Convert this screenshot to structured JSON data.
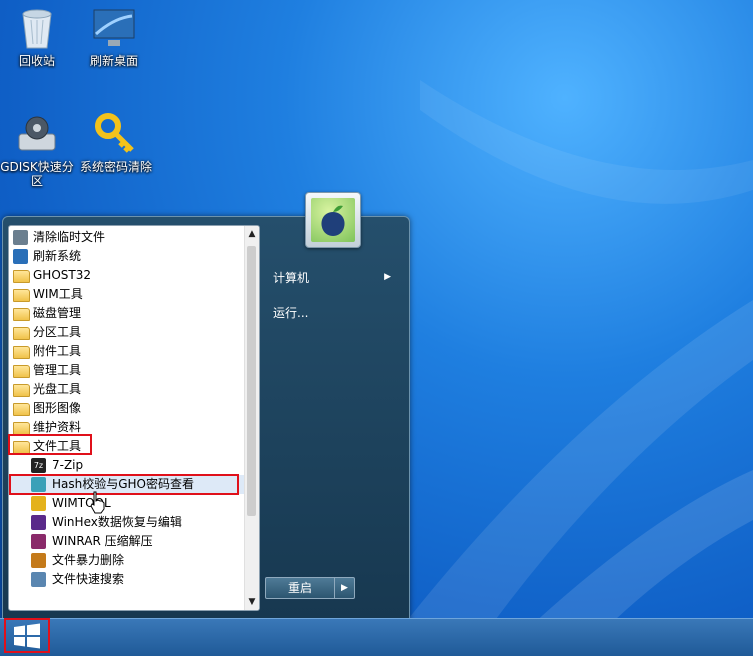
{
  "desktop": {
    "icons": [
      {
        "label": "回收站",
        "icon": "recycle-bin-icon"
      },
      {
        "label": "刷新桌面",
        "icon": "monitor-icon"
      },
      {
        "label": "GDISK快速分区",
        "icon": "gear-disk-icon"
      },
      {
        "label": "系统密码清除",
        "icon": "key-icon"
      }
    ]
  },
  "start_menu": {
    "programs": [
      {
        "label": "清除临时文件",
        "icon": "broom-icon",
        "level": 0
      },
      {
        "label": "刷新系统",
        "icon": "monitor-small-icon",
        "level": 0
      },
      {
        "label": "GHOST32",
        "icon": "folder-icon",
        "level": 0
      },
      {
        "label": "WIM工具",
        "icon": "folder-icon",
        "level": 0
      },
      {
        "label": "磁盘管理",
        "icon": "folder-icon",
        "level": 0
      },
      {
        "label": "分区工具",
        "icon": "folder-icon",
        "level": 0
      },
      {
        "label": "附件工具",
        "icon": "folder-icon",
        "level": 0
      },
      {
        "label": "管理工具",
        "icon": "folder-icon",
        "level": 0
      },
      {
        "label": "光盘工具",
        "icon": "folder-icon",
        "level": 0
      },
      {
        "label": "图形图像",
        "icon": "folder-icon",
        "level": 0
      },
      {
        "label": "维护资料",
        "icon": "folder-icon",
        "level": 0
      },
      {
        "label": "文件工具",
        "icon": "folder-icon",
        "level": 0
      },
      {
        "label": "7-Zip",
        "icon": "7zip-icon",
        "level": 1
      },
      {
        "label": "Hash校验与GHO密码查看",
        "icon": "hash-icon",
        "level": 1
      },
      {
        "label": "WIMTOOL",
        "icon": "wimtool-icon",
        "level": 1
      },
      {
        "label": "WinHex数据恢复与编辑",
        "icon": "winhex-icon",
        "level": 1
      },
      {
        "label": "WINRAR 压缩解压",
        "icon": "winrar-icon",
        "level": 1
      },
      {
        "label": "文件暴力删除",
        "icon": "force-delete-icon",
        "level": 1
      },
      {
        "label": "文件快速搜索",
        "icon": "file-search-icon",
        "level": 1
      }
    ],
    "right": {
      "computer_label": "计算机",
      "run_label": "运行...",
      "shutdown_label": "重启"
    }
  },
  "colors": {
    "highlight_box": "#e0101a",
    "desktop": "#1f7fe0"
  }
}
